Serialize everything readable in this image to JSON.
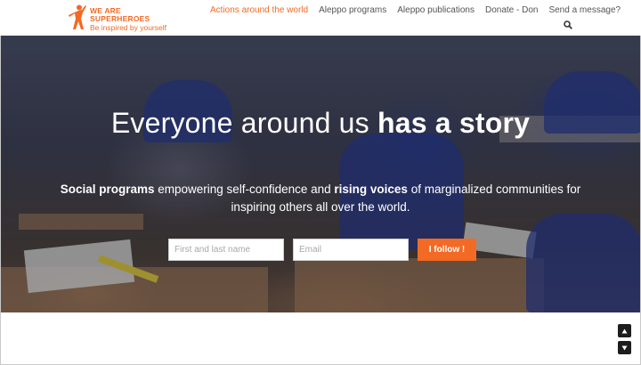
{
  "brand": {
    "line1": "WE ARE",
    "line2": "SUPERHEROES",
    "tagline": "Be inspired by yourself",
    "color": "#f26a24"
  },
  "nav": {
    "items": [
      {
        "label": "Actions around the world",
        "active": true
      },
      {
        "label": "Aleppo programs",
        "active": false
      },
      {
        "label": "Aleppo publications",
        "active": false
      },
      {
        "label": "Donate - Don",
        "active": false
      },
      {
        "label": "Send a message?",
        "active": false
      }
    ],
    "search_icon": "search-icon"
  },
  "hero": {
    "title_light": "Everyone around us",
    "title_bold": "has a story",
    "sub_part1_bold": "Social programs",
    "sub_part2": "empowering self-confidence and",
    "sub_part3_bold": "rising voices",
    "sub_part4": "of marginalized communities for inspiring others all over the world."
  },
  "form": {
    "name_placeholder": "First and last name",
    "email_placeholder": "Email",
    "submit_label": "I follow !"
  },
  "scroll": {
    "up_icon": "arrow-up-icon",
    "down_icon": "arrow-down-icon"
  }
}
